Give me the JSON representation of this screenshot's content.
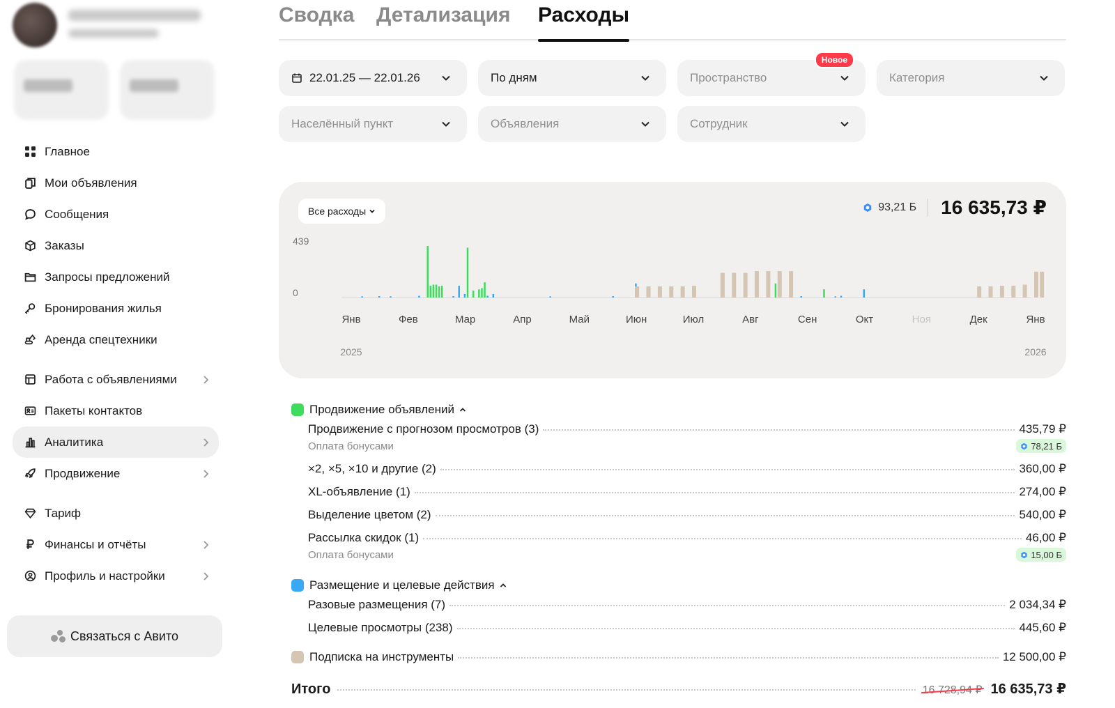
{
  "sidebar": {
    "nav": [
      {
        "label": "Главное",
        "icon": "grid-icon"
      },
      {
        "label": "Мои объявления",
        "icon": "copy-icon"
      },
      {
        "label": "Сообщения",
        "icon": "chat-icon"
      },
      {
        "label": "Заказы",
        "icon": "box-icon"
      },
      {
        "label": "Запросы предложений",
        "icon": "folder-icon"
      },
      {
        "label": "Бронирования жилья",
        "icon": "key-icon"
      },
      {
        "label": "Аренда спецтехники",
        "icon": "excavator-icon"
      },
      {
        "label": "Работа с объявлениями",
        "icon": "board-icon",
        "chevron": true
      },
      {
        "label": "Пакеты контактов",
        "icon": "contact-card-icon"
      },
      {
        "label": "Аналитика",
        "icon": "bar-chart-icon",
        "chevron": true,
        "active": true
      },
      {
        "label": "Продвижение",
        "icon": "rocket-icon",
        "chevron": true
      },
      {
        "label": "Тариф",
        "icon": "diamond-icon"
      },
      {
        "label": "Финансы и отчёты",
        "icon": "ruble-icon",
        "chevron": true
      },
      {
        "label": "Профиль и настройки",
        "icon": "user-circle-icon",
        "chevron": true
      }
    ],
    "contact_button": "Связаться с Авито"
  },
  "tabs": [
    {
      "label": "Сводка",
      "active": false
    },
    {
      "label": "Детализация",
      "active": false
    },
    {
      "label": "Расходы",
      "active": true
    }
  ],
  "filters": {
    "date": "22.01.25 — 22.01.26",
    "period": "По дням",
    "space": "Пространство",
    "space_badge": "Новое",
    "category": "Категория",
    "city": "Населённый пункт",
    "ads": "Объявления",
    "employee": "Сотрудник"
  },
  "chart_header": {
    "selector": "Все расходы",
    "bonus": "93,21 Б",
    "total": "16 635,73 ₽"
  },
  "chart_data": {
    "type": "bar",
    "y_tick_labels": [
      "439",
      "0"
    ],
    "ylim": [
      0,
      439
    ],
    "x_tick_labels": [
      "Янв",
      "Фев",
      "Мар",
      "Апр",
      "Май",
      "Июн",
      "Июл",
      "Авг",
      "Сен",
      "Окт",
      "Ноя",
      "Дек",
      "Янв"
    ],
    "year_labels": [
      "2025",
      "2026"
    ],
    "series": [
      {
        "name": "Продвижение объявлений",
        "color": "#3ddc5c",
        "points": [
          [
            1.35,
            439
          ],
          [
            1.4,
            100
          ],
          [
            1.45,
            110
          ],
          [
            1.5,
            110
          ],
          [
            1.55,
            95
          ],
          [
            1.6,
            100
          ],
          [
            2.05,
            425
          ],
          [
            2.15,
            60
          ],
          [
            2.25,
            70
          ],
          [
            2.3,
            80
          ],
          [
            2.35,
            130
          ],
          [
            7.45,
            120
          ],
          [
            8.3,
            70
          ]
        ]
      },
      {
        "name": "Размещение и целевые действия",
        "color": "#3aa9f5",
        "points": [
          [
            0.2,
            10
          ],
          [
            0.5,
            12
          ],
          [
            0.7,
            10
          ],
          [
            1.2,
            15
          ],
          [
            1.8,
            12
          ],
          [
            2.0,
            30
          ],
          [
            2.4,
            15
          ],
          [
            2.5,
            30
          ],
          [
            1.9,
            100
          ],
          [
            5.0,
            120
          ],
          [
            3.5,
            10
          ],
          [
            4.6,
            12
          ],
          [
            7.1,
            10
          ],
          [
            7.9,
            12
          ],
          [
            8.5,
            10
          ],
          [
            9.0,
            70
          ],
          [
            8.6,
            15
          ]
        ]
      },
      {
        "name": "Подписка на инструменты",
        "color": "#d4c6b2",
        "points": [
          [
            5.0,
            95
          ],
          [
            5.2,
            95
          ],
          [
            5.4,
            95
          ],
          [
            5.6,
            95
          ],
          [
            5.8,
            95
          ],
          [
            6.0,
            100
          ],
          [
            6.5,
            210
          ],
          [
            6.7,
            210
          ],
          [
            6.9,
            210
          ],
          [
            7.1,
            225
          ],
          [
            7.3,
            225
          ],
          [
            7.5,
            225
          ],
          [
            7.7,
            225
          ],
          [
            11.0,
            95
          ],
          [
            11.2,
            95
          ],
          [
            11.4,
            100
          ],
          [
            11.6,
            100
          ],
          [
            11.8,
            110
          ],
          [
            12.0,
            220
          ],
          [
            12.1,
            220
          ]
        ]
      }
    ]
  },
  "details": {
    "groups": [
      {
        "name": "Продвижение объявлений",
        "color": "#3ddc5c",
        "rows": [
          {
            "label": "Продвижение с прогнозом просмотров (3)",
            "amount": "435,79 ₽",
            "sub": "Оплата бонусами",
            "bonus": "78,21 Б"
          },
          {
            "label": "×2, ×5, ×10 и другие (2)",
            "amount": "360,00 ₽"
          },
          {
            "label": "XL-объявление (1)",
            "amount": "274,00 ₽"
          },
          {
            "label": "Выделение цветом (2)",
            "amount": "540,00 ₽"
          },
          {
            "label": "Рассылка скидок (1)",
            "amount": "46,00 ₽",
            "sub": "Оплата бонусами",
            "bonus": "15,00 Б"
          }
        ]
      },
      {
        "name": "Размещение и целевые действия",
        "color": "#3aa9f5",
        "rows": [
          {
            "label": "Разовые размещения (7)",
            "amount": "2 034,34 ₽"
          },
          {
            "label": "Целевые просмотры (238)",
            "amount": "445,60 ₽"
          }
        ]
      },
      {
        "name": "Подписка на инструменты",
        "color": "#d4c6b2",
        "amount": "12 500,00 ₽"
      }
    ],
    "total_label": "Итого",
    "total_old": "16 728,94 ₽",
    "total": "16 635,73 ₽"
  }
}
